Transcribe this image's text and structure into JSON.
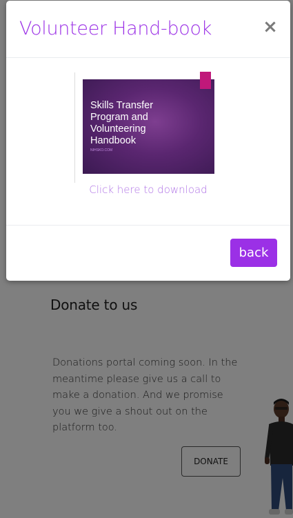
{
  "modal": {
    "title": "Volunteer Hand-book",
    "close_symbol": "×",
    "thumbnail_text": "Skills Transfer\nProgram and\nVolunteering\nHandbook",
    "thumbnail_small": "NIHSKO.COM",
    "download_link": "Click here to download",
    "back_label": "back"
  },
  "donate": {
    "title": "Donate to us",
    "description": "Donations portal coming soon. In the meantime please give us a call to make a donation. And we promise you we give a shout out on the platform too.",
    "button_label": "DONATE"
  },
  "colors": {
    "accent": "#9b30e6",
    "link": "#b074e6",
    "overlay": "rgba(0,0,0,0.5)"
  }
}
